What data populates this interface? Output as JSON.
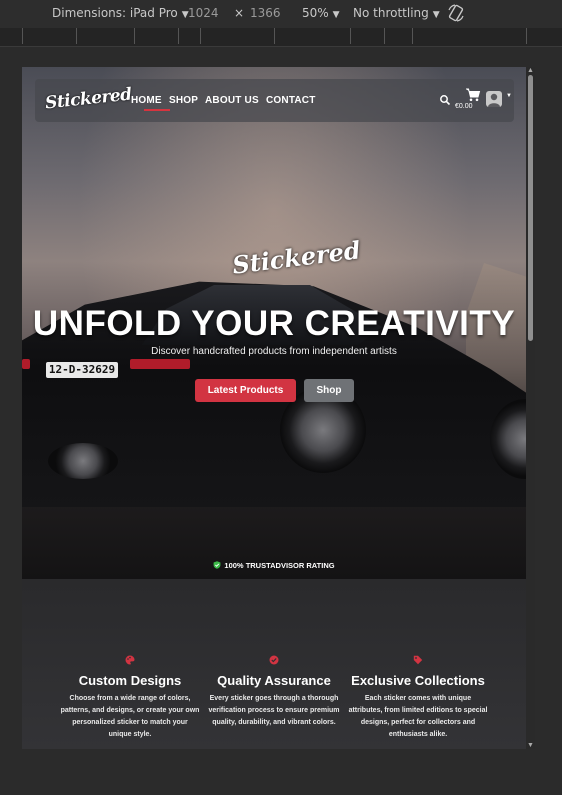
{
  "devtools": {
    "dimensions_label": "Dimensions: iPad Pro",
    "width": "1024",
    "times": "×",
    "height": "1366",
    "zoom": "50%",
    "throttling": "No throttling"
  },
  "nav": {
    "logo": "Stickered",
    "links": [
      "HOME",
      "SHOP",
      "ABOUT US",
      "CONTACT"
    ],
    "cart_total": "€0.00"
  },
  "hero": {
    "logo": "Stickered",
    "title": "UNFOLD YOUR CREATIVITY",
    "subtitle": "Discover handcrafted products from independent artists",
    "plate": "12-D-32629",
    "primary_button": "Latest Products",
    "secondary_button": "Shop",
    "trust": "100% TRUSTADVISOR RATING"
  },
  "features": [
    {
      "title": "Custom Designs",
      "text": "Choose from a wide range of colors, patterns, and designs, or create your own personalized sticker to match your unique style.",
      "icon": "palette-icon"
    },
    {
      "title": "Quality Assurance",
      "text": "Every sticker goes through a thorough verification process to ensure premium quality, durability, and vibrant colors.",
      "icon": "check-badge-icon"
    },
    {
      "title": "Exclusive Collections",
      "text": "Each sticker comes with unique attributes, from limited editions to special designs, perfect for collectors and enthusiasts alike.",
      "icon": "tag-icon"
    }
  ],
  "colors": {
    "accent": "#d23442",
    "secondary": "#6f7276",
    "trust_green": "#3dbb4a"
  }
}
